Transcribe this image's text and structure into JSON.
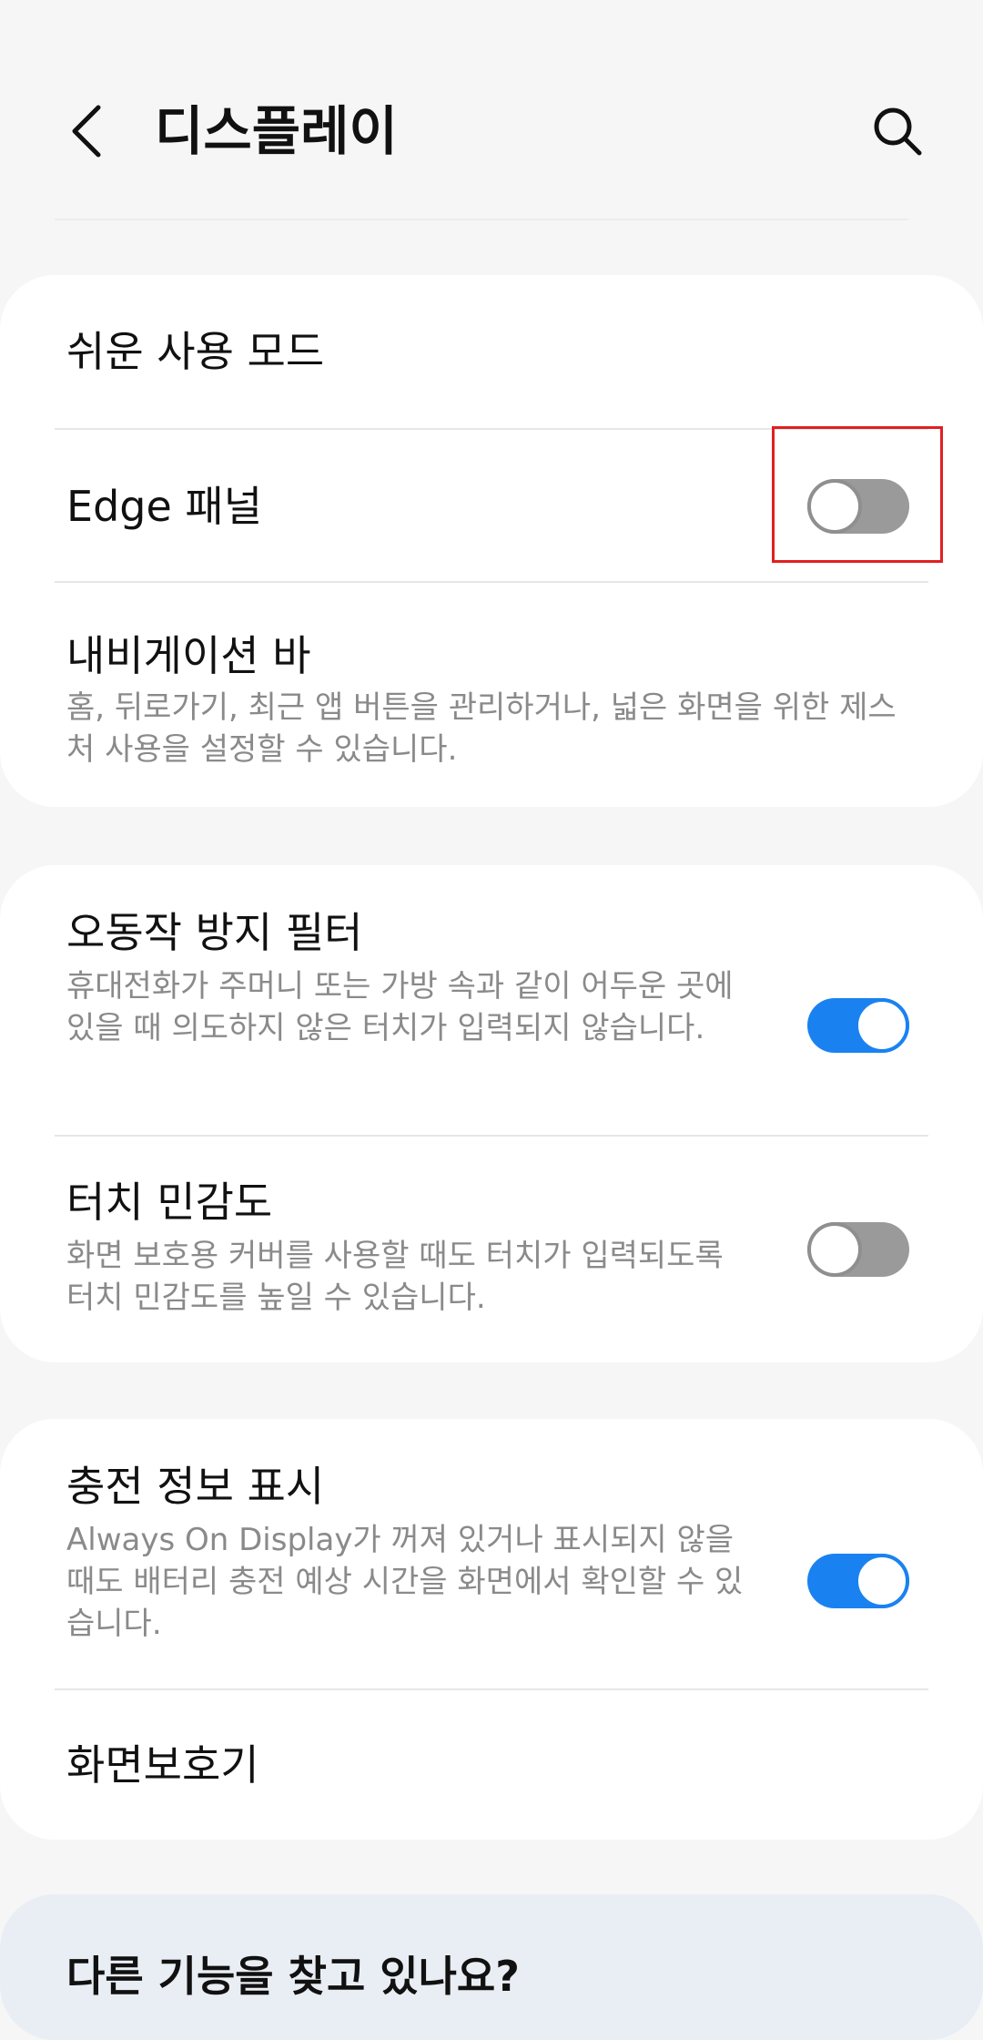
{
  "header": {
    "title": "디스플레이",
    "back_icon": "chevron-left-icon",
    "search_icon": "search-icon"
  },
  "group1": {
    "easy_mode": {
      "title": "쉬운 사용 모드"
    },
    "edge_panel": {
      "title": "Edge 패널",
      "toggle": "off"
    },
    "navigation_bar": {
      "title": "내비게이션 바",
      "subtitle": "홈, 뒤로가기, 최근 앱 버튼을 관리하거나, 넓은 화면을 위한 제스처 사용을 설정할 수 있습니다."
    }
  },
  "group2": {
    "accidental_touch": {
      "title": "오동작 방지 필터",
      "subtitle": "휴대전화가 주머니 또는 가방 속과 같이 어두운 곳에 있을 때 의도하지 않은 터치가 입력되지 않습니다.",
      "toggle": "on"
    },
    "touch_sensitivity": {
      "title": "터치 민감도",
      "subtitle": "화면 보호용 커버를 사용할 때도 터치가 입력되도록 터치 민감도를 높일 수 있습니다.",
      "toggle": "off"
    }
  },
  "group3": {
    "charging_info": {
      "title": "충전 정보 표시",
      "subtitle": "Always On Display가 꺼져 있거나 표시되지 않을 때도 배터리 충전 예상 시간을 화면에서 확인할 수 있습니다.",
      "toggle": "on"
    },
    "screensaver": {
      "title": "화면보호기"
    }
  },
  "bottom": {
    "title": "다른 기능을 찾고 있나요?"
  },
  "colors": {
    "background": "#f6f6f6",
    "card": "#ffffff",
    "toggle_on": "#1a82f0",
    "toggle_off": "#9a9a9a",
    "highlight": "#e02020",
    "suggestion_card": "#e9eef4"
  }
}
